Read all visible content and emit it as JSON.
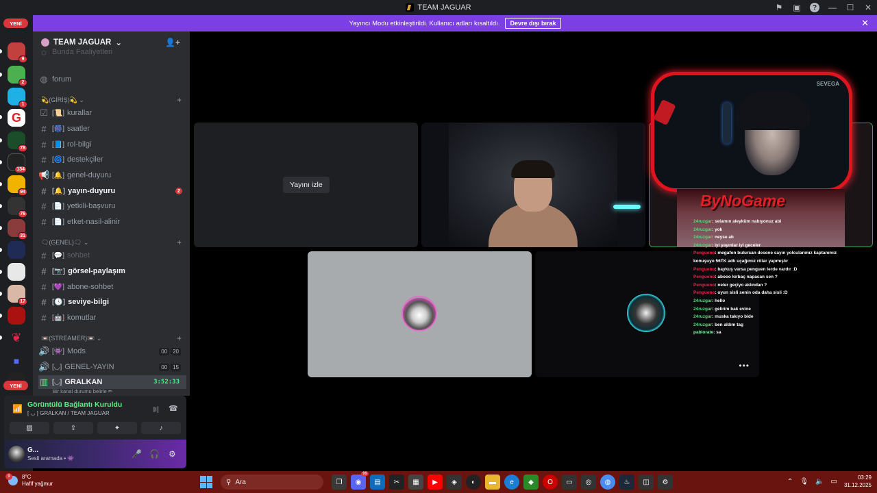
{
  "window": {
    "title": "TEAM JAGUAR"
  },
  "banner": {
    "text": "Yayıncı Modu etkinleştirildi. Kullanıcı adları kısaltıldı.",
    "button": "Devre dışı bırak",
    "close": "✕"
  },
  "rail": {
    "new_label": "YENİ",
    "badges": [
      "9",
      "2",
      "1",
      "78",
      "134",
      "94",
      "76",
      "31",
      "17"
    ]
  },
  "server": {
    "name": "TEAM JAGUAR"
  },
  "channels": {
    "faded_top": "Bunda Faaliyetleri",
    "forum": "forum",
    "cat1": "💫(GİRİŞ)💫",
    "c_kurallar": "kurallar",
    "c_saatler": "saatler",
    "c_rolbilgi": "rol-bilgi",
    "c_destekciler": "destekçiler",
    "c_genelduyuru": "genel-duyuru",
    "c_yayinduyuru": "yayın-duyuru",
    "c_yayinduyuru_badge": "2",
    "c_yetkili": "yetkili-başvuru",
    "c_etket": "etket-nasil-alinir",
    "cat2": "🗨(GENEL)🗨",
    "c_sohbet": "sohbet",
    "c_gorsel": "görsel-paylaşım",
    "c_abone": "abone-sohbet",
    "c_seviye": "seviye-bilgi",
    "c_komutlar": "komutlar",
    "cat3": "📼(STREAMER)📼",
    "v_mods": "Mods",
    "v_mods_users": [
      "00",
      "20"
    ],
    "v_genel": "GENEL-YAYIN",
    "v_genel_users": [
      "00",
      "15"
    ],
    "v_gralkan": "GRALKAN",
    "v_gralkan_timer": "3:52:33",
    "v_gralkan_status": "Bir kanal durumu belirle ✏"
  },
  "voice": {
    "title": "Görüntülü Bağlantı Kuruldu",
    "sub": "[ ◡ ] GRALKAN / TEAM JAGUAR"
  },
  "user": {
    "name": "G...",
    "status": "Sesli aramada • 👾"
  },
  "stage": {
    "watch": "Yayını izle",
    "more": "•••",
    "overlay_tag": "SEVEGA",
    "logo": "ByNoGame"
  },
  "chat": [
    {
      "u": "24ruzgar",
      "c": "u1",
      "t": ": selamın aleyküm nabıyonuz abi"
    },
    {
      "u": "24ruzgar",
      "c": "u1",
      "t": ": yok"
    },
    {
      "u": "24ruzgar",
      "c": "u1",
      "t": ": neyse ab"
    },
    {
      "u": "24ruzgar",
      "c": "u1",
      "t": ": iyi yayınlar iyi geceler"
    },
    {
      "u": "Pengueno",
      "c": "u2",
      "t": ": megafon bulursan desene sayın yolcularımız kaptanımız"
    },
    {
      "u": "",
      "c": "u2",
      "t": "konuşuyo 56TK adlı uçağımız rötar yapmıştır"
    },
    {
      "u": "Pengueno",
      "c": "u2",
      "t": ": baykuş varsa penguen lerde vardır :D"
    },
    {
      "u": "Pengueno",
      "c": "u2",
      "t": ": abooo kırbaç napacan sen ?"
    },
    {
      "u": "Pengueno",
      "c": "u2",
      "t": ": neler geçiyo aklından ?"
    },
    {
      "u": "Pengueno",
      "c": "u2",
      "t": ": oyun sisli senin oda daha sisli :D"
    },
    {
      "u": "24ruzgar",
      "c": "u1",
      "t": ": hello"
    },
    {
      "u": "24ruzgar",
      "c": "u1",
      "t": ": gelirim bak evine"
    },
    {
      "u": "24ruzgar",
      "c": "u1",
      "t": ": muska takıyo bide"
    },
    {
      "u": "24ruzgar",
      "c": "u1",
      "t": ": ben aldım tag"
    },
    {
      "u": "pablorate",
      "c": "u3",
      "t": ": sa"
    }
  ],
  "taskbar": {
    "temp": "8°C",
    "weather": "Hafif yağmur",
    "weather_badge": "9",
    "search": "Ara",
    "time": "03:29",
    "date": "31.12.2025",
    "discord_badge": "99"
  }
}
